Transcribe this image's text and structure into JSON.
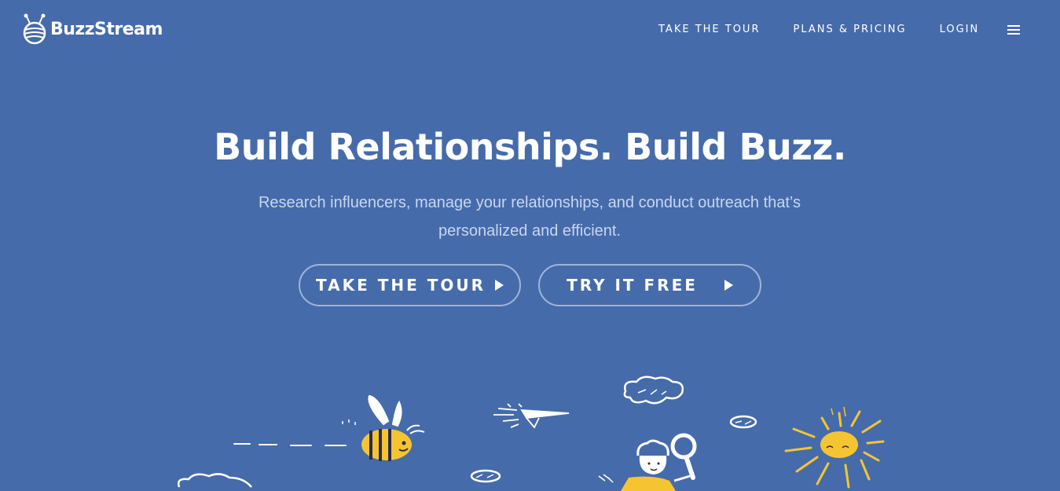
{
  "header": {
    "logo_text": "BuzzStream",
    "nav": {
      "tour": "TAKE THE TOUR",
      "plans": "PLANS & PRICING",
      "login": "LOGIN"
    },
    "menu_icon": "hamburger-menu-icon"
  },
  "hero": {
    "title": "Build Relationships. Build Buzz.",
    "subtitle": "Research influencers, manage your relationships, and conduct outreach that’s personalized and efficient.",
    "buttons": {
      "tour": "TAKE THE TOUR",
      "free": "TRY IT FREE"
    },
    "button_icon": "play-arrow-icon"
  },
  "illustration": {
    "elements": [
      "bee-icon",
      "paper-plane-icon",
      "cloud-icon",
      "sun-icon",
      "child-with-magnifying-glass-icon"
    ]
  },
  "colors": {
    "background": "#466bab",
    "text": "#ffffff",
    "subtitle": "#c8d6ef",
    "button_border": "#9fb4d9",
    "accent_yellow": "#f5c531"
  }
}
